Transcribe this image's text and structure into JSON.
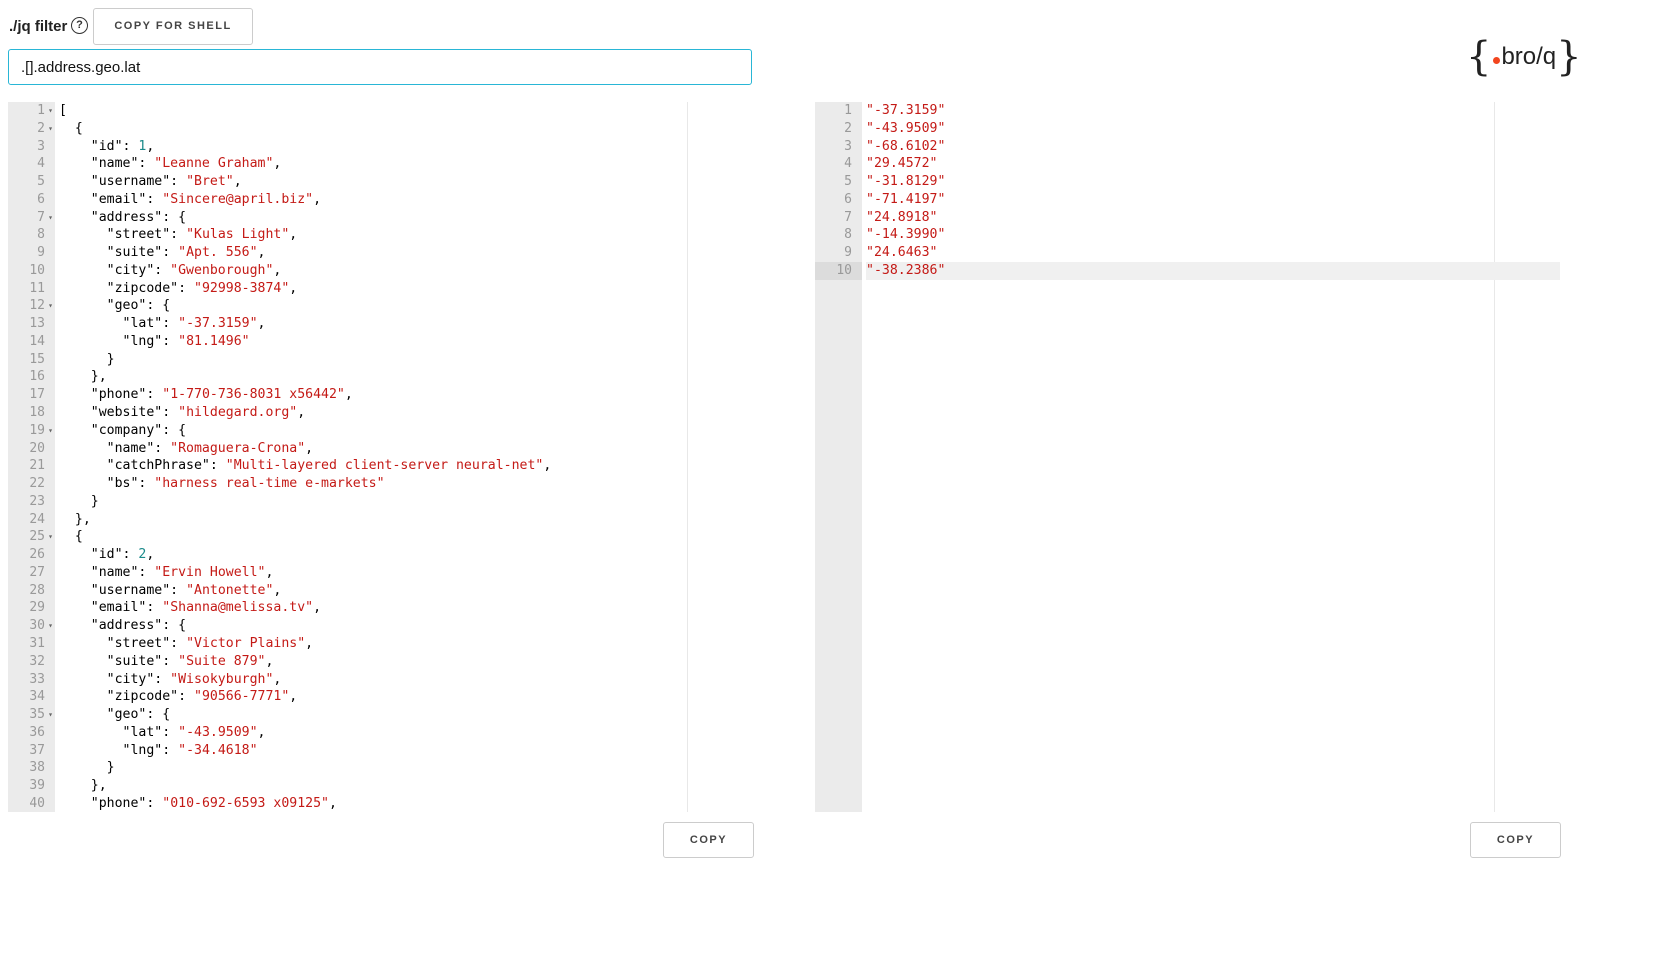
{
  "header": {
    "filter_label": "./jq filter",
    "help_icon": "?",
    "copy_for_shell": "COPY FOR SHELL",
    "filter_value": ".[].address.geo.lat",
    "logo_text": "bro/q",
    "logo_dot_color": "#f2451e"
  },
  "input_editor": {
    "fold_lines": [
      1,
      2,
      7,
      12,
      19,
      25,
      30,
      35
    ],
    "lines": [
      "[",
      "  {",
      "    \"id\": 1,",
      "    \"name\": \"Leanne Graham\",",
      "    \"username\": \"Bret\",",
      "    \"email\": \"Sincere@april.biz\",",
      "    \"address\": {",
      "      \"street\": \"Kulas Light\",",
      "      \"suite\": \"Apt. 556\",",
      "      \"city\": \"Gwenborough\",",
      "      \"zipcode\": \"92998-3874\",",
      "      \"geo\": {",
      "        \"lat\": \"-37.3159\",",
      "        \"lng\": \"81.1496\"",
      "      }",
      "    },",
      "    \"phone\": \"1-770-736-8031 x56442\",",
      "    \"website\": \"hildegard.org\",",
      "    \"company\": {",
      "      \"name\": \"Romaguera-Crona\",",
      "      \"catchPhrase\": \"Multi-layered client-server neural-net\",",
      "      \"bs\": \"harness real-time e-markets\"",
      "    }",
      "  },",
      "  {",
      "    \"id\": 2,",
      "    \"name\": \"Ervin Howell\",",
      "    \"username\": \"Antonette\",",
      "    \"email\": \"Shanna@melissa.tv\",",
      "    \"address\": {",
      "      \"street\": \"Victor Plains\",",
      "      \"suite\": \"Suite 879\",",
      "      \"city\": \"Wisokyburgh\",",
      "      \"zipcode\": \"90566-7771\",",
      "      \"geo\": {",
      "        \"lat\": \"-43.9509\",",
      "        \"lng\": \"-34.4618\"",
      "      }",
      "    },",
      "    \"phone\": \"010-692-6593 x09125\","
    ],
    "copy_label": "COPY"
  },
  "output_editor": {
    "active_line": 10,
    "lines": [
      "\"-37.3159\"",
      "\"-43.9509\"",
      "\"-68.6102\"",
      "\"29.4572\"",
      "\"-31.8129\"",
      "\"-71.4197\"",
      "\"24.8918\"",
      "\"-14.3990\"",
      "\"24.6463\"",
      "\"-38.2386\""
    ],
    "copy_label": "COPY"
  }
}
